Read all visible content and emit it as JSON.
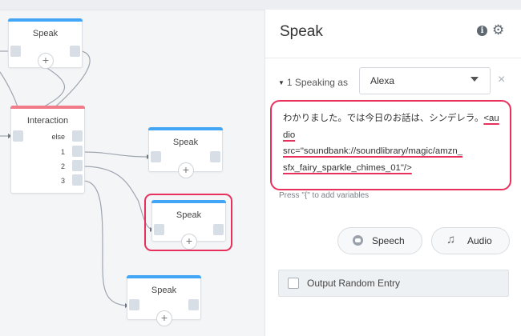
{
  "canvas": {
    "nodes": [
      {
        "id": "speak_top",
        "title": "Speak"
      },
      {
        "id": "interaction",
        "title": "Interaction",
        "choices": [
          "else",
          "1",
          "2",
          "3"
        ]
      },
      {
        "id": "speak_mid",
        "title": "Speak"
      },
      {
        "id": "speak_selected",
        "title": "Speak",
        "selected": true
      },
      {
        "id": "speak_bottom",
        "title": "Speak"
      }
    ],
    "add_glyph": "+"
  },
  "panel": {
    "title": "Speak",
    "info_glyph": "i",
    "settings_glyph": "⚙",
    "speaking_prefix": "1 Speaking as",
    "voice": "Alexa",
    "close_glyph": "×",
    "text_plain": "わかりました。では今日のお話は、シンデレラ。",
    "text_tag_open": "<audio",
    "text_src_line1": "src=\"soundbank://soundlibrary/magic/amzn_",
    "text_src_line2": "sfx_fairy_sparkle_chimes_01\"/>",
    "hint": "Press \"{\" to add variables",
    "speech_button": "Speech",
    "audio_button": "Audio",
    "random_entry_label": "Output Random Entry"
  },
  "colors": {
    "speak_accent": "#42a5f5",
    "interaction_accent": "#f17b89",
    "highlight": "#e8305d"
  },
  "icons": [
    "info-icon",
    "gear-icon",
    "close-icon",
    "caret-down-icon",
    "speech-icon",
    "music-note-icon",
    "plus-icon"
  ]
}
